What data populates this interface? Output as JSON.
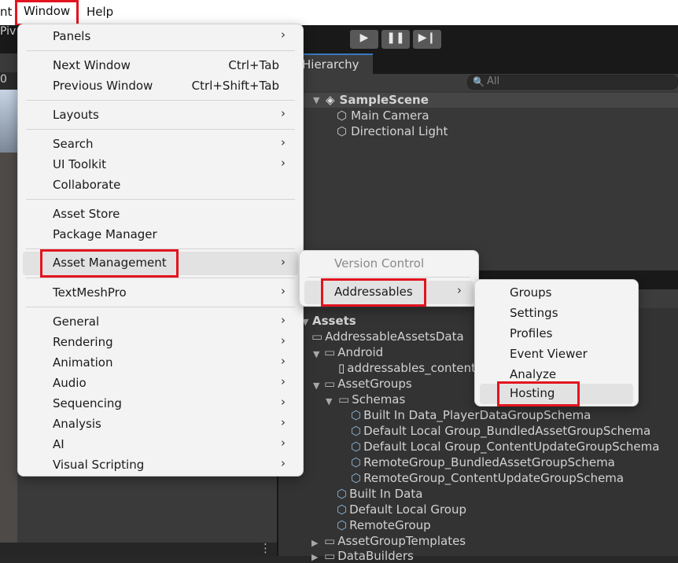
{
  "menubar": {
    "items": [
      {
        "label": "nt"
      },
      {
        "label": "Window"
      },
      {
        "label": "Help"
      }
    ]
  },
  "toolbar": {
    "partial_label": "Piv",
    "play_icon": "play-icon",
    "pause_icon": "pause-icon",
    "step_icon": "step-icon"
  },
  "scene": {
    "tab_fragment": "0"
  },
  "window_menu": {
    "items": [
      {
        "label": "Panels",
        "shortcut": "",
        "submenu": true
      },
      {
        "label": "Next Window",
        "shortcut": "Ctrl+Tab",
        "submenu": false
      },
      {
        "label": "Previous Window",
        "shortcut": "Ctrl+Shift+Tab",
        "submenu": false
      },
      {
        "label": "Layouts",
        "shortcut": "",
        "submenu": true
      },
      {
        "label": "Search",
        "shortcut": "",
        "submenu": true
      },
      {
        "label": "UI Toolkit",
        "shortcut": "",
        "submenu": true
      },
      {
        "label": "Collaborate",
        "shortcut": "",
        "submenu": false
      },
      {
        "label": "Asset Store",
        "shortcut": "",
        "submenu": false
      },
      {
        "label": "Package Manager",
        "shortcut": "",
        "submenu": false
      },
      {
        "label": "Asset Management",
        "shortcut": "",
        "submenu": true
      },
      {
        "label": "TextMeshPro",
        "shortcut": "",
        "submenu": true
      },
      {
        "label": "General",
        "shortcut": "",
        "submenu": true
      },
      {
        "label": "Rendering",
        "shortcut": "",
        "submenu": true
      },
      {
        "label": "Animation",
        "shortcut": "",
        "submenu": true
      },
      {
        "label": "Audio",
        "shortcut": "",
        "submenu": true
      },
      {
        "label": "Sequencing",
        "shortcut": "",
        "submenu": true
      },
      {
        "label": "Analysis",
        "shortcut": "",
        "submenu": true
      },
      {
        "label": "AI",
        "shortcut": "",
        "submenu": true
      },
      {
        "label": "Visual Scripting",
        "shortcut": "",
        "submenu": true
      }
    ],
    "submenu_arrow": "›"
  },
  "asset_management_menu": {
    "items": [
      {
        "label": "Version Control"
      },
      {
        "label": "Addressables"
      }
    ]
  },
  "addressables_menu": {
    "items": [
      {
        "label": "Groups"
      },
      {
        "label": "Settings"
      },
      {
        "label": "Profiles"
      },
      {
        "label": "Event Viewer"
      },
      {
        "label": "Analyze"
      },
      {
        "label": "Hosting"
      }
    ]
  },
  "hierarchy": {
    "tab": "Hierarchy",
    "search_placeholder": "All",
    "scene": "SampleScene",
    "objects": [
      "Main Camera",
      "Directional Light"
    ]
  },
  "project": {
    "root": "Assets",
    "tree": [
      "AddressableAssetsData",
      "Android",
      "addressables_content",
      "AssetGroups",
      "Schemas",
      "Built In Data_PlayerDataGroupSchema",
      "Default Local Group_BundledAssetGroupSchema",
      "Default Local Group_ContentUpdateGroupSchema",
      "RemoteGroup_BundledAssetGroupSchema",
      "RemoteGroup_ContentUpdateGroupSchema",
      "Built In Data",
      "Default Local Group",
      "RemoteGroup",
      "AssetGroupTemplates",
      "DataBuilders"
    ]
  },
  "colors": {
    "highlight_outline": "#e3141f",
    "menu_background": "#f3f3f3",
    "editor_dark": "#282828",
    "accent_blue": "#3a79bb"
  }
}
